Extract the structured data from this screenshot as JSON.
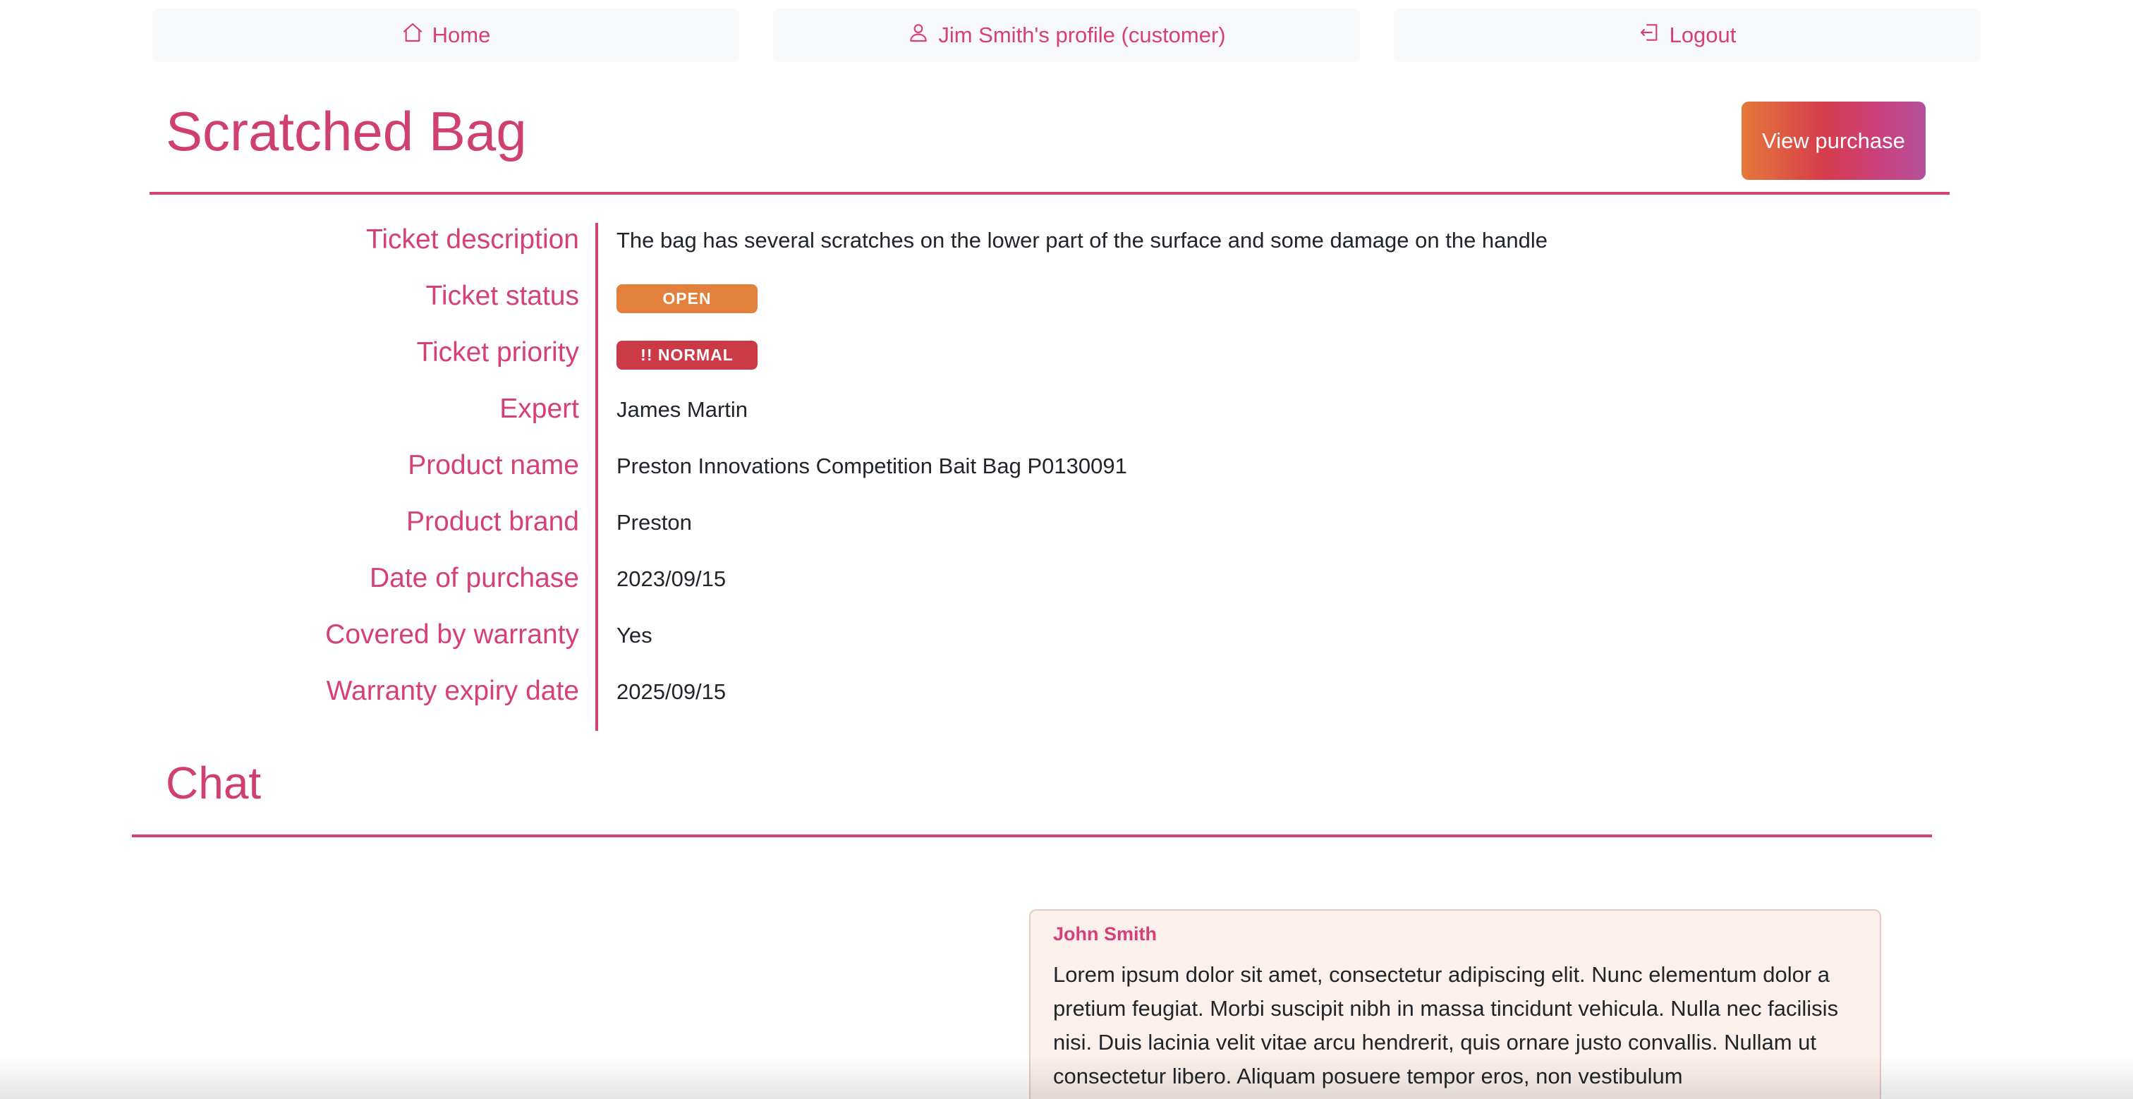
{
  "nav": {
    "home": "Home",
    "profile": "Jim Smith's profile (customer)",
    "logout": "Logout"
  },
  "ticket": {
    "title": "Scratched Bag",
    "view_purchase": "View purchase",
    "fields": {
      "description_label": "Ticket description",
      "description_value": "The bag has several scratches on the lower part of the surface and some damage on the handle",
      "status_label": "Ticket status",
      "status_value": "OPEN",
      "priority_label": "Ticket priority",
      "priority_value": "!! NORMAL",
      "expert_label": "Expert",
      "expert_value": "James Martin",
      "product_name_label": "Product name",
      "product_name_value": "Preston Innovations Competition Bait Bag P0130091",
      "product_brand_label": "Product brand",
      "product_brand_value": "Preston",
      "purchase_date_label": "Date of purchase",
      "purchase_date_value": "2023/09/15",
      "warranty_label": "Covered by warranty",
      "warranty_value": "Yes",
      "warranty_expiry_label": "Warranty expiry date",
      "warranty_expiry_value": "2025/09/15"
    }
  },
  "chat": {
    "title": "Chat",
    "messages": [
      {
        "author": "John Smith",
        "text": "Lorem ipsum dolor sit amet, consectetur adipiscing elit. Nunc elementum dolor a pretium feugiat. Morbi suscipit nibh in massa tincidunt vehicula. Nulla nec facilisis nisi. Duis lacinia velit vitae arcu hendrerit, quis ornare justo convallis. Nullam ut consectetur libero. Aliquam posuere tempor eros, non vestibulum"
      }
    ]
  },
  "colors": {
    "accent": "#d63f77",
    "status_open": "#e3813c",
    "priority_normal": "#cd3a47",
    "message_bg": "#fbf0ec"
  },
  "icons": {
    "home": "house-icon",
    "profile": "person-icon",
    "logout": "logout-icon"
  }
}
